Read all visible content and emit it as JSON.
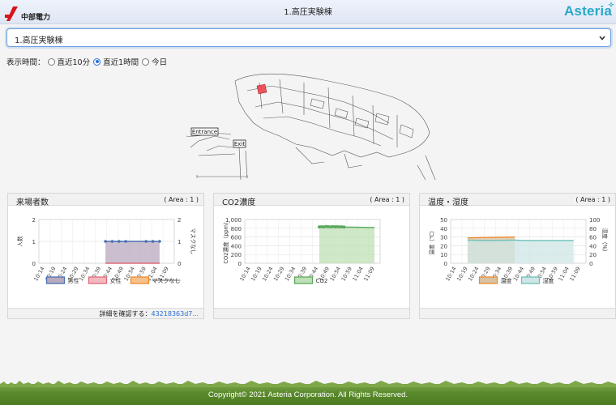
{
  "header": {
    "corp_name": "中部電力",
    "title": "1.高圧実験棟",
    "brand": "Asteria"
  },
  "building_select": {
    "value": "1.高圧実験棟"
  },
  "display_time": {
    "label": "表示時間：",
    "options": [
      "直近10分",
      "直近1時間",
      "今日"
    ],
    "selected": "直近1時間"
  },
  "map": {
    "labels": {
      "entrance": "Entrance",
      "exit": "Exit"
    }
  },
  "panels": [
    {
      "title": "来場者数",
      "area": "( Area : 1 )",
      "detail_label": "詳細を確認する：",
      "detail_link": "43218363d7..."
    },
    {
      "title": "CO2濃度",
      "area": "( Area : 1 )"
    },
    {
      "title": "温度・湿度",
      "area": "( Area : 1 )"
    }
  ],
  "chart_data": [
    {
      "type": "area",
      "categories": [
        "10:14",
        "10:19",
        "10:24",
        "10:29",
        "10:34",
        "10:39",
        "10:44",
        "10:49",
        "10:54",
        "10:59",
        "11:04",
        "11:09"
      ],
      "ylabel": "人数",
      "y2label": "マスクなし",
      "ylim": [
        0,
        2
      ],
      "yticks": [
        0,
        1,
        2
      ],
      "y2ticks": [
        0,
        1,
        2
      ],
      "series": [
        {
          "name": "男性",
          "color": "#4a6fb3",
          "fill": "#b9a9bf",
          "points": [
            [
              5.4,
              1
            ],
            [
              6,
              1
            ],
            [
              6.6,
              1
            ],
            [
              7.2,
              1
            ],
            [
              9,
              1
            ],
            [
              9.6,
              1
            ],
            [
              10.2,
              1
            ]
          ]
        },
        {
          "name": "女性",
          "color": "#e06a78",
          "fill": "#f4b8c0",
          "points": [
            [
              5.4,
              0
            ],
            [
              10.2,
              0
            ]
          ]
        },
        {
          "name": "マスクなし",
          "color": "#ef8a2a",
          "fill": "#f6c18b",
          "points": []
        }
      ],
      "legend": [
        "男性",
        "女性",
        "マスクなし"
      ],
      "legend_struck": [
        false,
        false,
        true
      ],
      "grid": true,
      "legend_position": "bottom"
    },
    {
      "type": "area",
      "categories": [
        "10:14",
        "10:19",
        "10:24",
        "10:29",
        "10:34",
        "10:39",
        "10:44",
        "10:49",
        "10:54",
        "10:59",
        "11:04",
        "11:09"
      ],
      "ylabel": "CO2濃度（ppm）",
      "ylim": [
        0,
        1000
      ],
      "yticks": [
        0,
        200,
        400,
        600,
        800,
        "1,000"
      ],
      "series": [
        {
          "name": "CO2",
          "color": "#5aa85a",
          "fill": "#bfe0b6",
          "points": [
            [
              6.1,
              830
            ],
            [
              6.3,
              835
            ],
            [
              6.5,
              830
            ],
            [
              6.7,
              840
            ],
            [
              6.9,
              835
            ],
            [
              7.1,
              830
            ],
            [
              7.3,
              838
            ],
            [
              7.5,
              832
            ],
            [
              7.7,
              836
            ],
            [
              7.9,
              830
            ],
            [
              8.1,
              834
            ],
            [
              8.3,
              828
            ],
            [
              8.6,
              826
            ],
            [
              9.0,
              824
            ],
            [
              9.5,
              822
            ],
            [
              10.0,
              820
            ],
            [
              10.5,
              818
            ],
            [
              11,
              818
            ]
          ]
        }
      ],
      "legend": [
        "CO2"
      ],
      "grid": true,
      "legend_position": "bottom"
    },
    {
      "type": "area",
      "categories": [
        "10:14",
        "10:19",
        "10:24",
        "10:29",
        "10:34",
        "10:39",
        "10:44",
        "10:49",
        "10:54",
        "10:59",
        "11:04",
        "11:09"
      ],
      "ylabel": "温度（℃）",
      "y2label": "湿度（%）",
      "ylim": [
        0,
        50
      ],
      "y2lim": [
        0,
        100
      ],
      "yticks": [
        0,
        10,
        20,
        30,
        40,
        50
      ],
      "y2ticks": [
        0,
        20,
        40,
        60,
        80,
        100
      ],
      "series": [
        {
          "name": "温度",
          "color": "#ef8a2a",
          "fill": "#d8c2a3",
          "points": [
            [
              1,
              29
            ],
            [
              3.2,
              29.5
            ],
            [
              5.2,
              30
            ]
          ]
        },
        {
          "name": "湿度",
          "color": "#6cc0b9",
          "fill": "#cfe6e6",
          "axis": "right",
          "points": [
            [
              1,
              53
            ],
            [
              3,
              52
            ],
            [
              5.2,
              53
            ],
            [
              6,
              52
            ],
            [
              7,
              52
            ],
            [
              8,
              52
            ],
            [
              9,
              52
            ],
            [
              10,
              52
            ],
            [
              10.4,
              52
            ]
          ]
        }
      ],
      "legend": [
        "温度",
        "湿度"
      ],
      "grid": true,
      "legend_position": "bottom"
    }
  ],
  "footer": {
    "copyright": "Copyright© 2021 Asteria Corporation. All Rights Reserved."
  }
}
